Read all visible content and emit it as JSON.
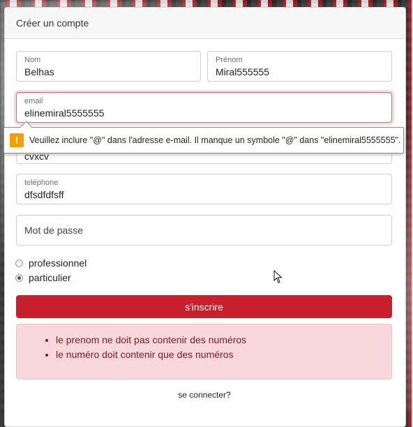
{
  "card": {
    "title": "Créer un compte"
  },
  "form": {
    "nom": {
      "label": "Nom",
      "value": "Belhas"
    },
    "prenom": {
      "label": "Prénom",
      "value": "Miral555555"
    },
    "email": {
      "label": "email",
      "value": "elinemiral5555555"
    },
    "hidden_field_partial": {
      "value": "cvxcv"
    },
    "telephone": {
      "label": "teléphone",
      "value": "dfsdfdfsff"
    },
    "password": {
      "placeholder": "Mot de passe"
    },
    "radios": [
      {
        "label": "professionnel",
        "checked": false
      },
      {
        "label": "particulier",
        "checked": true
      }
    ],
    "submit_label": "s'inscrire"
  },
  "tooltip": {
    "icon": "warning-icon",
    "message": "Veuillez inclure \"@\" dans l'adresse e-mail. Il manque un symbole \"@\" dans \"elinemiral5555555\"."
  },
  "errors": [
    "le prenom ne doit pas contenir des numéros",
    "le numéro doit contenir que des numéros"
  ],
  "login_link": "se connecter?",
  "colors": {
    "primary": "#c81f2c",
    "alert_bg": "#f8d7da",
    "alert_text": "#721c24",
    "warning": "#f4a000"
  }
}
